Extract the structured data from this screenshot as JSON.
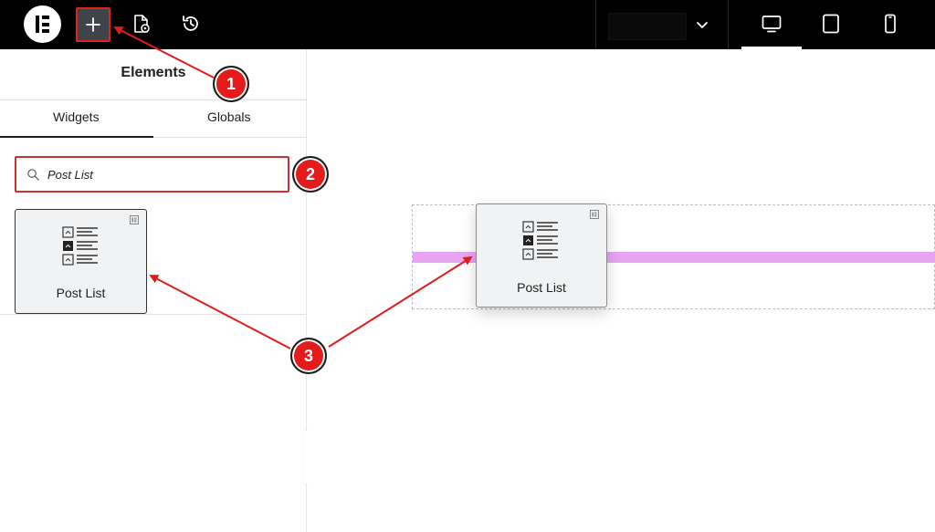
{
  "panel": {
    "title": "Elements",
    "tabs": [
      {
        "label": "Widgets",
        "active": true
      },
      {
        "label": "Globals",
        "active": false
      }
    ],
    "search": {
      "value": "Post List",
      "placeholder": ""
    },
    "widgets": [
      {
        "label": "Post List",
        "icon": "post-list-icon"
      }
    ]
  },
  "canvas": {
    "dragging_widget": {
      "label": "Post List",
      "icon": "post-list-icon"
    }
  },
  "annotations": [
    {
      "number": "1"
    },
    {
      "number": "2"
    },
    {
      "number": "3"
    }
  ],
  "colors": {
    "accent": "#e31b1b",
    "drop_indicator": "#e6a4f2",
    "topbar": "#000000"
  }
}
